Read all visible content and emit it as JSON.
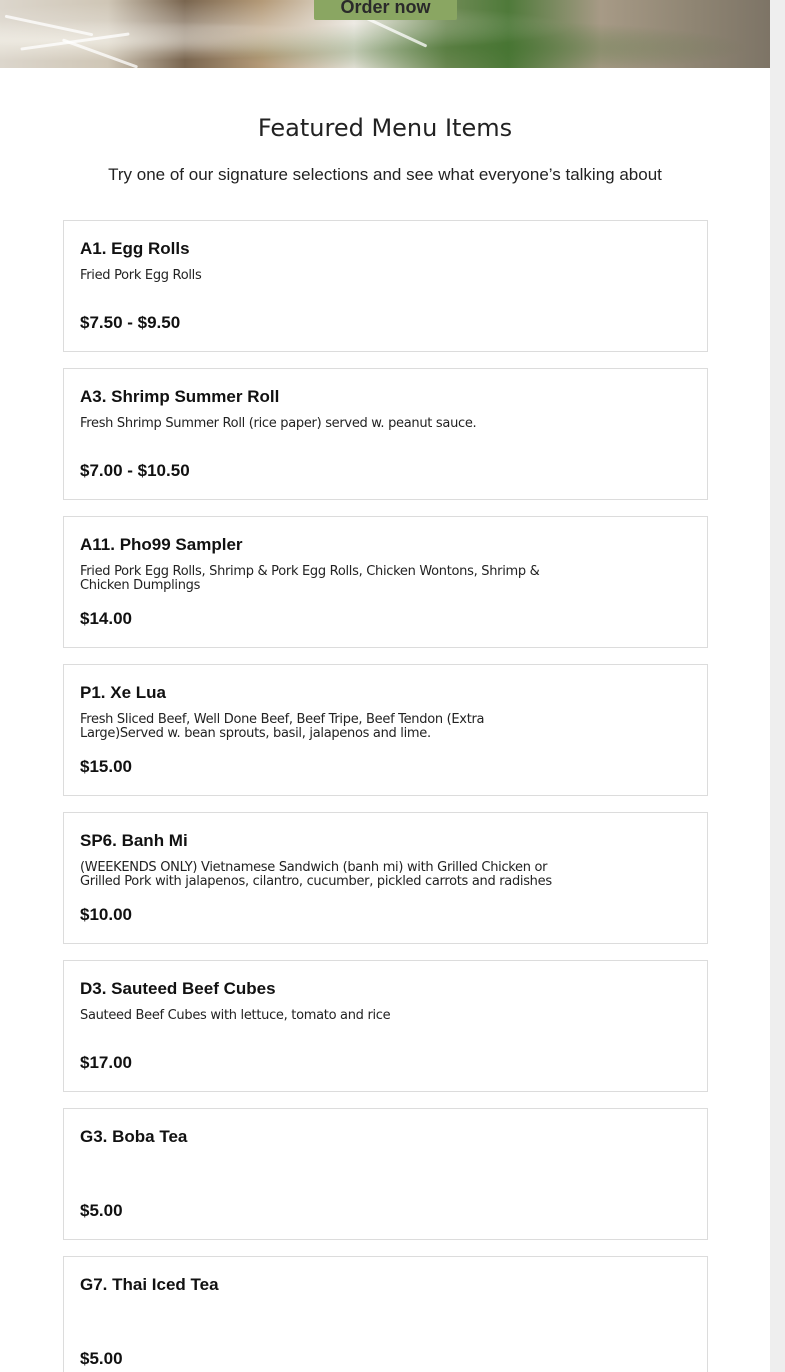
{
  "hero": {
    "order_button_label": "Order now"
  },
  "featured": {
    "title": "Featured Menu Items",
    "subtitle": "Try one of our signature selections and see what everyone’s talking about",
    "items": [
      {
        "name": "A1. Egg Rolls",
        "description": "Fried Pork Egg Rolls",
        "price": "$7.50 - $9.50"
      },
      {
        "name": "A3. Shrimp Summer Roll",
        "description": "Fresh Shrimp Summer Roll (rice paper) served w. peanut sauce.",
        "price": "$7.00 - $10.50"
      },
      {
        "name": "A11. Pho99 Sampler",
        "description": "Fried Pork Egg Rolls, Shrimp & Pork Egg Rolls, Chicken Wontons, Shrimp & Chicken Dumplings",
        "price": "$14.00"
      },
      {
        "name": "P1. Xe Lua",
        "description": "Fresh Sliced Beef, Well Done Beef, Beef Tripe, Beef Tendon (Extra Large)Served w. bean sprouts, basil, jalapenos and lime.",
        "price": "$15.00"
      },
      {
        "name": "SP6. Banh Mi",
        "description": "(WEEKENDS ONLY) Vietnamese Sandwich (banh mi) with Grilled Chicken or Grilled Pork with jalapenos, cilantro, cucumber, pickled carrots and radishes",
        "price": "$10.00"
      },
      {
        "name": "D3. Sauteed Beef Cubes",
        "description": "Sauteed Beef Cubes with lettuce, tomato and rice",
        "price": "$17.00"
      },
      {
        "name": "G3. Boba Tea",
        "description": "",
        "price": "$5.00"
      },
      {
        "name": "G7. Thai Iced Tea",
        "description": "",
        "price": "$5.00"
      }
    ]
  },
  "colors": {
    "order_button_bg": "#8aa662",
    "card_border": "#dcdcdc",
    "scrollbar_track": "#eeeeee"
  }
}
